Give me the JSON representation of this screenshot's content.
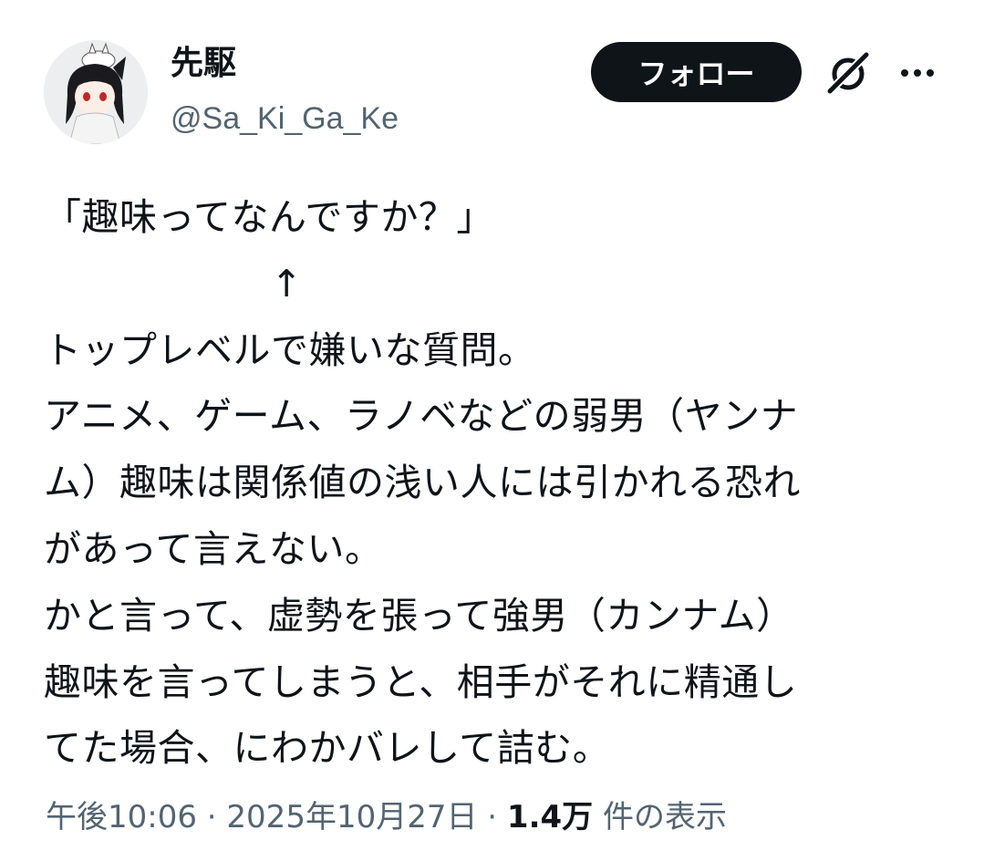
{
  "author": {
    "name": "先駆",
    "handle": "@Sa_Ki_Ga_Ke"
  },
  "actions": {
    "follow_label": "フォロー",
    "grok_icon": "grok-icon",
    "more_icon": "more-icon"
  },
  "tweet": {
    "lines": [
      "「趣味ってなんですか？」",
      "　　　　　　↑",
      "トップレベルで嫌いな質問。",
      "アニメ、ゲーム、ラノベなどの弱男（ヤンナ",
      "ム）趣味は関係値の浅い人には引かれる恐れ",
      "があって言えない。",
      "かと言って、虚勢を張って強男（カンナム）",
      "趣味を言ってしまうと、相手がそれに精通し",
      "てた場合、にわかバレして詰む。"
    ]
  },
  "meta": {
    "time": "午後10:06",
    "date": "2025年10月27日",
    "views_count": "1.4万",
    "views_label": "件の表示",
    "separator": "·"
  },
  "colors": {
    "text": "#0f1419",
    "secondary": "#536471",
    "button_bg": "#0f1419"
  }
}
